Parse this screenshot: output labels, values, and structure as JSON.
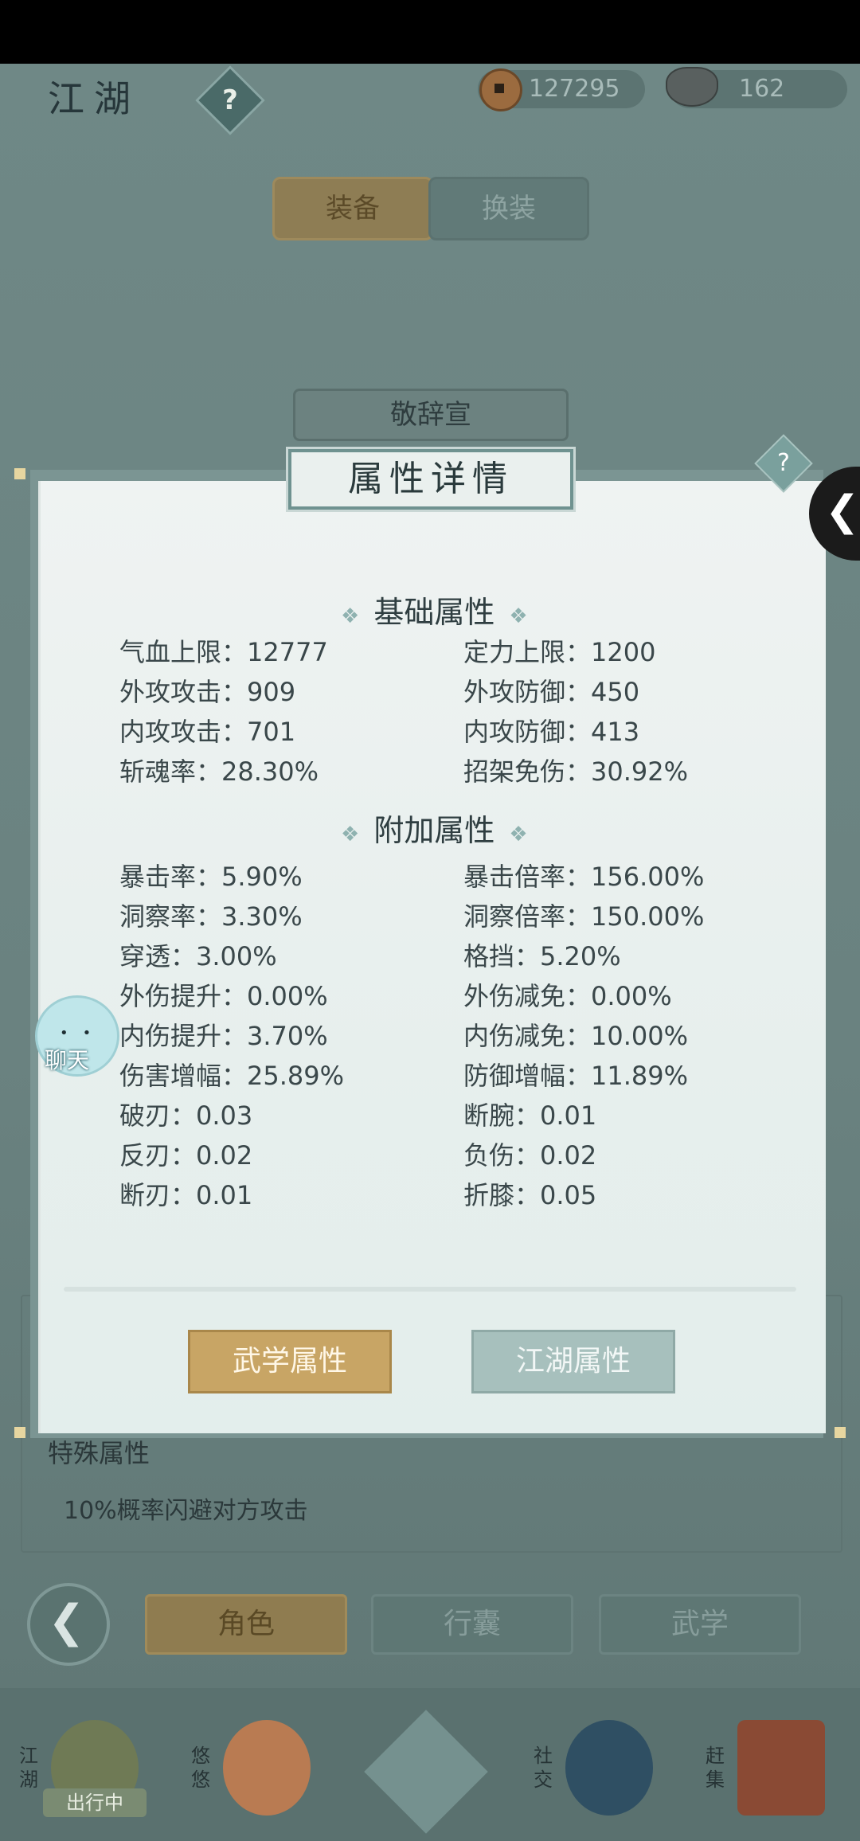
{
  "header": {
    "title": "江湖",
    "help_icon": "?",
    "coins": "127295",
    "silver": "162"
  },
  "top_tabs": {
    "equip": "装备",
    "swap": "换装"
  },
  "character_name": "敬辞宣",
  "panel": {
    "title": "属性详情",
    "help_icon": "?",
    "base_section": "基础属性",
    "base_stats": [
      [
        "气血上限：12777",
        "定力上限：1200"
      ],
      [
        "外攻攻击：909",
        "外攻防御：450"
      ],
      [
        "内攻攻击：701",
        "内攻防御：413"
      ],
      [
        "斩魂率：28.30%",
        "招架免伤：30.92%"
      ]
    ],
    "extra_section": "附加属性",
    "extra_stats": [
      [
        "暴击率：5.90%",
        "暴击倍率：156.00%"
      ],
      [
        "洞察率：3.30%",
        "洞察倍率：150.00%"
      ],
      [
        "穿透：3.00%",
        "格挡：5.20%"
      ],
      [
        "外伤提升：0.00%",
        "外伤减免：0.00%"
      ],
      [
        "内伤提升：3.70%",
        "内伤减免：10.00%"
      ],
      [
        "伤害增幅：25.89%",
        "防御增幅：11.89%"
      ],
      [
        "破刃：0.03",
        "断腕：0.01"
      ],
      [
        "反刃：0.02",
        "负伤：0.02"
      ],
      [
        "断刃：0.01",
        "折膝：0.05"
      ]
    ],
    "btn_martial": "武学属性",
    "btn_jianghu": "江湖属性"
  },
  "special": {
    "title": "特殊属性",
    "text": "10%概率闪避对方攻击"
  },
  "bottom_tabs": {
    "role": "角色",
    "bag": "行囊",
    "martial": "武学"
  },
  "chat_label": "聊天",
  "bottom_nav": {
    "jianghu": "江湖",
    "status": "出行中",
    "youyou": "悠悠",
    "social": "社交",
    "market": "赶集"
  }
}
